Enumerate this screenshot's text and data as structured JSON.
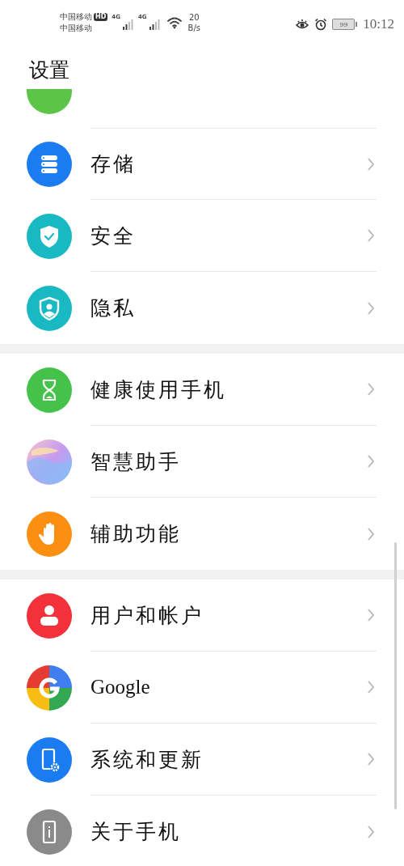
{
  "status_bar": {
    "carriers": [
      "中国移动",
      "中国移动"
    ],
    "hd": "HD",
    "networks": [
      "4G",
      "4G"
    ],
    "speed_value": "20",
    "speed_unit": "B/s",
    "battery": "99",
    "time": "10:12"
  },
  "title": "设置",
  "groups": [
    {
      "items": [
        {
          "kind": "cut"
        },
        {
          "kind": "storage",
          "label": "存储"
        },
        {
          "kind": "security",
          "label": "安全"
        },
        {
          "kind": "privacy",
          "label": "隐私"
        }
      ]
    },
    {
      "items": [
        {
          "kind": "health",
          "label": "健康使用手机"
        },
        {
          "kind": "assistant",
          "label": "智慧助手"
        },
        {
          "kind": "accessibility",
          "label": "辅助功能"
        }
      ]
    },
    {
      "items": [
        {
          "kind": "users",
          "label": "用户和帐户"
        },
        {
          "kind": "google",
          "label": "Google"
        },
        {
          "kind": "system",
          "label": "系统和更新"
        },
        {
          "kind": "about",
          "label": "关于手机"
        }
      ]
    }
  ]
}
